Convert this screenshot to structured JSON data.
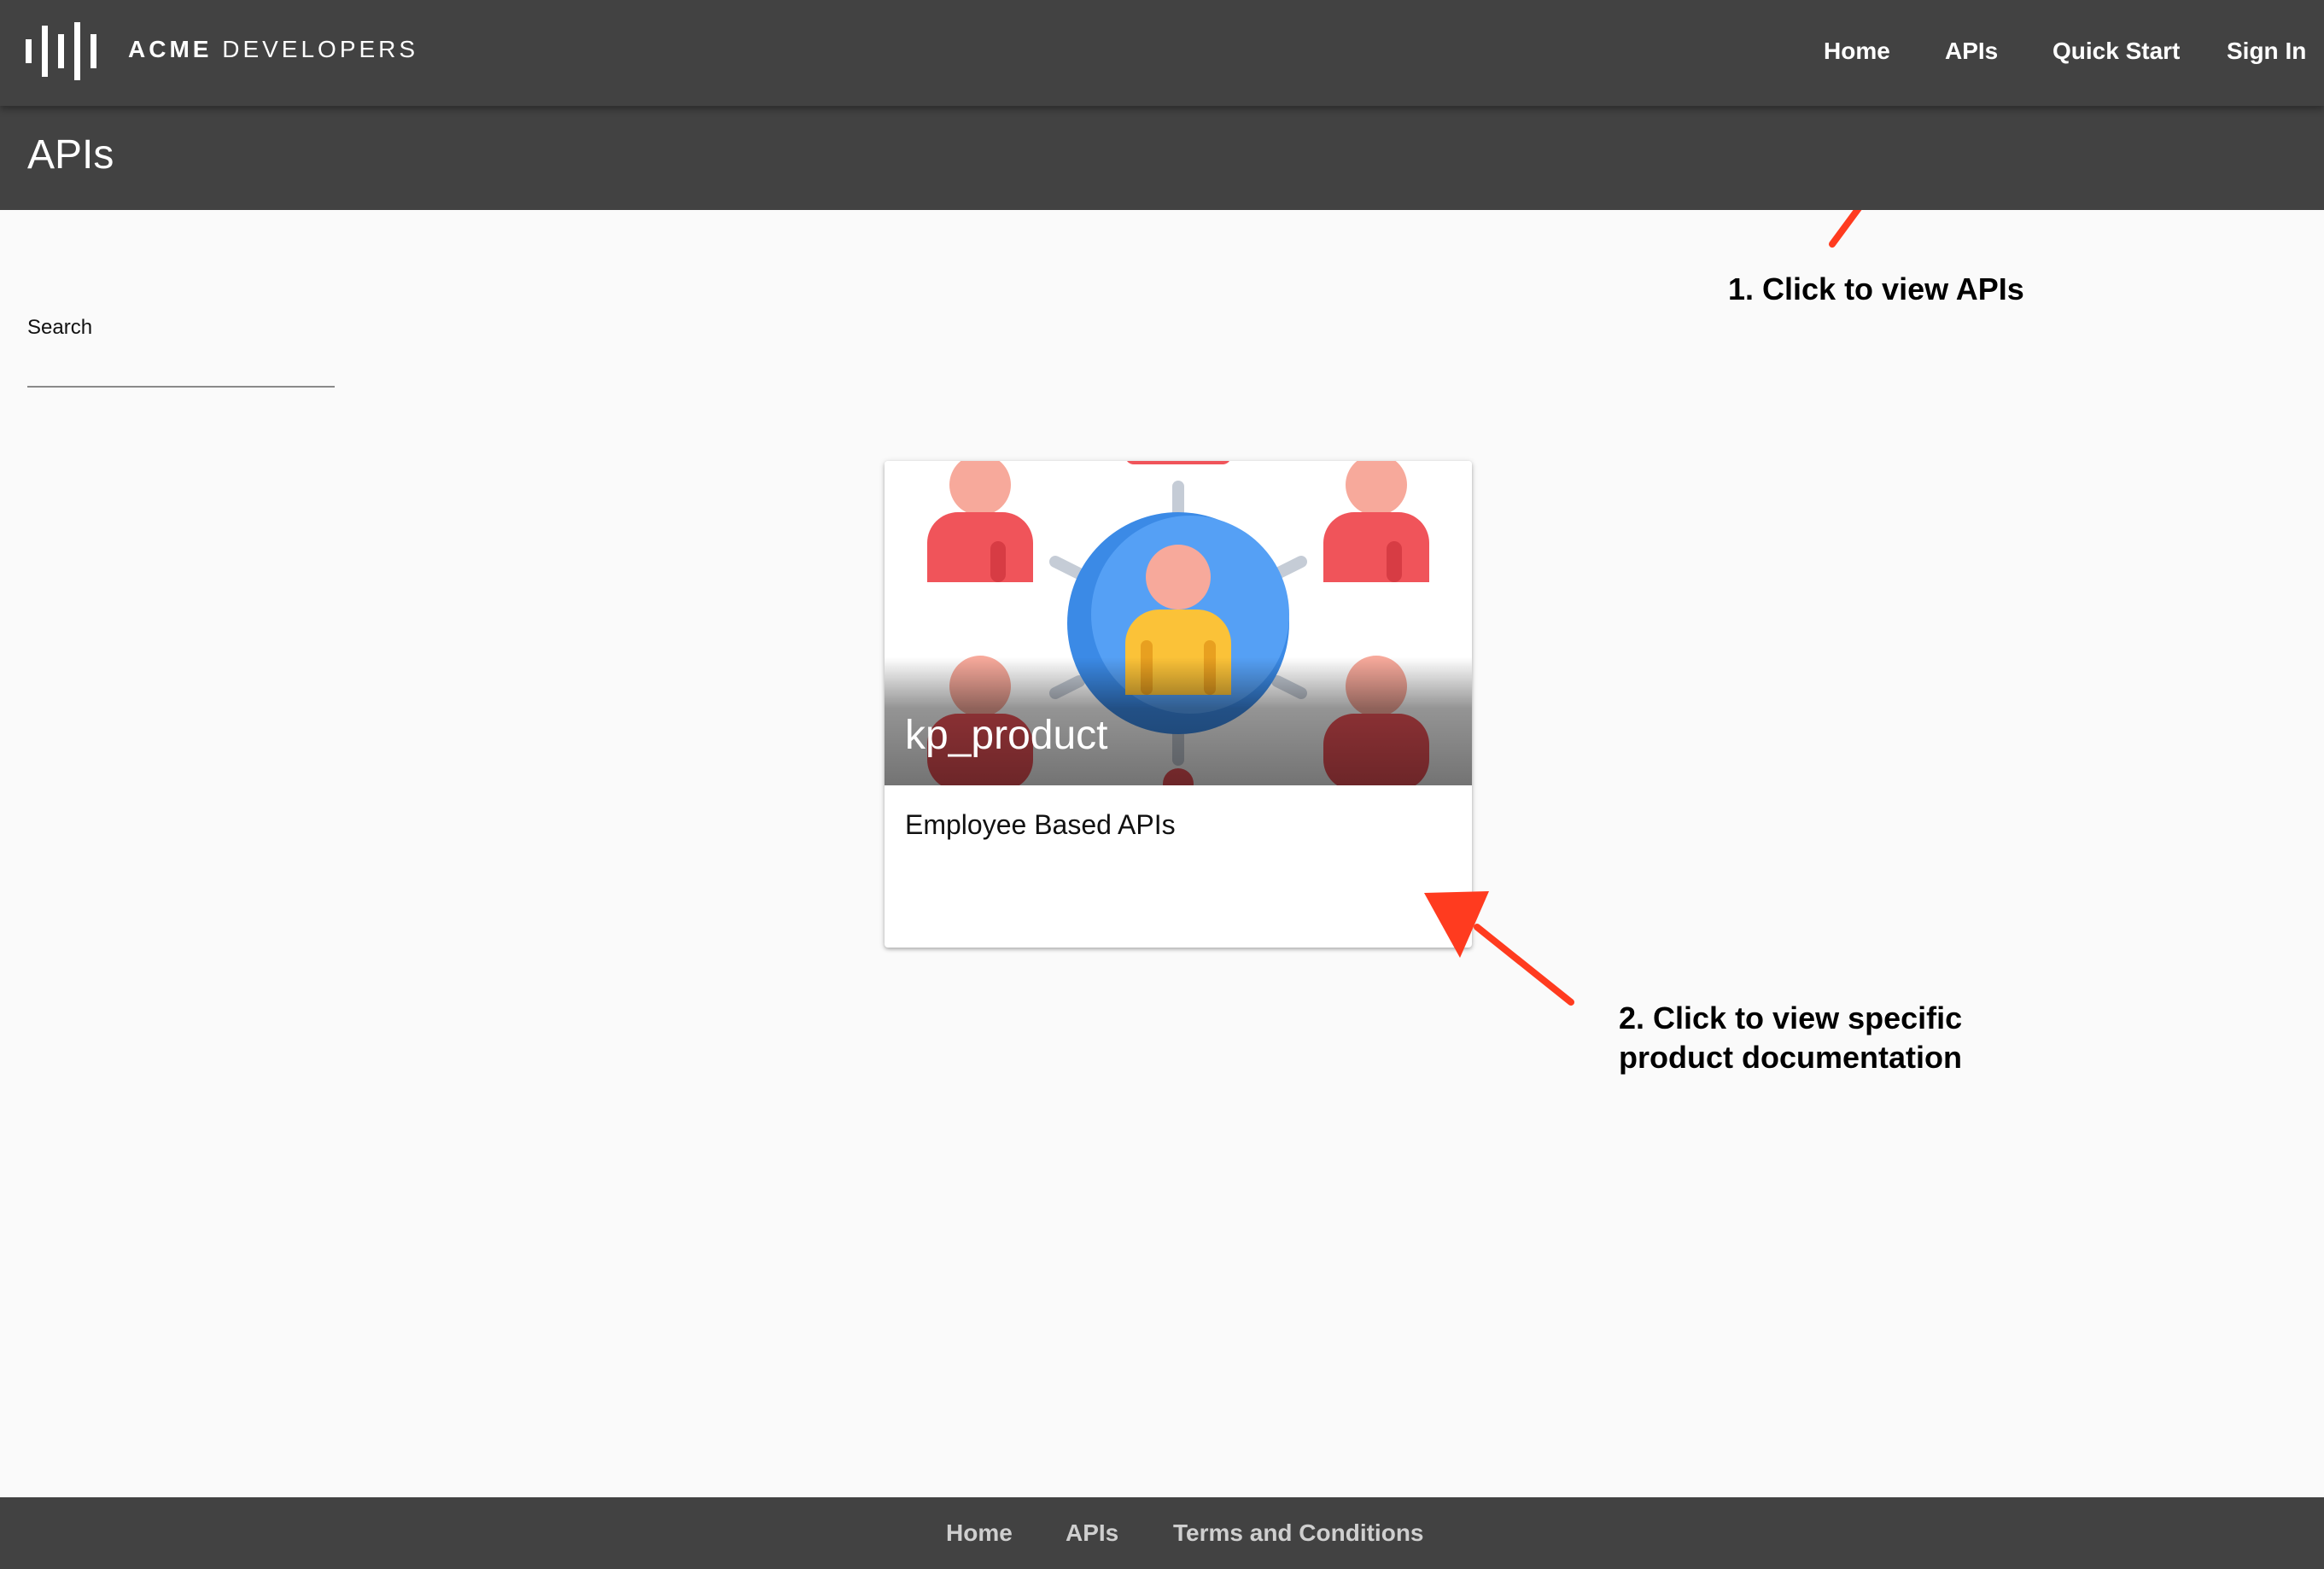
{
  "header": {
    "brand_bold": "ACME",
    "brand_rest": "DEVELOPERS",
    "logo_icon": "soundwave-logo-icon",
    "nav": [
      "Home",
      "APIs",
      "Quick Start",
      "Sign In"
    ]
  },
  "page": {
    "title": "APIs"
  },
  "search": {
    "label": "Search",
    "value": ""
  },
  "card": {
    "title": "kp_product",
    "description": "Employee Based APIs",
    "image_icon": "people-network-icon"
  },
  "annotations": {
    "step1": "1. Click to view APIs",
    "step2_line1": "2. Click to view specific",
    "step2_line2": "product documentation",
    "color": "#ff3b1f"
  },
  "footer": {
    "links": [
      "Home",
      "APIs",
      "Terms and Conditions"
    ]
  },
  "colors": {
    "bar": "#424242",
    "background": "#fafafa"
  }
}
